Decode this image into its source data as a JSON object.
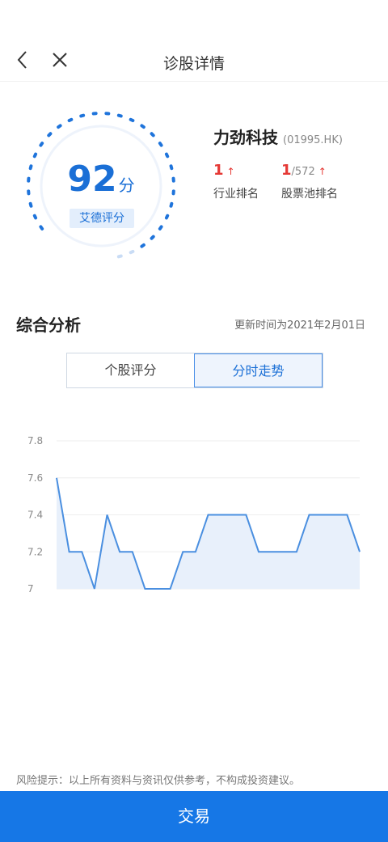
{
  "nav": {
    "title": "诊股详情",
    "back_icon": "chevron-left-icon",
    "close_icon": "close-icon"
  },
  "score": {
    "value": "92",
    "unit": "分",
    "label": "艾德评分",
    "level": 0.92
  },
  "stock": {
    "name": "力劲科技",
    "code": "(01995.HK)",
    "industry_rank": {
      "value": "1",
      "label": "行业排名"
    },
    "pool_rank": {
      "value": "1",
      "total": "/572",
      "label": "股票池排名"
    }
  },
  "analysis": {
    "title": "综合分析",
    "update_time": "更新时间为2021年2月01日"
  },
  "tabs": [
    {
      "label": "个股评分",
      "active": false
    },
    {
      "label": "分时走势",
      "active": true
    }
  ],
  "chart_data": {
    "type": "area",
    "ylim": [
      7,
      7.8
    ],
    "yticks": [
      "7.8",
      "7.6",
      "7.4",
      "7.2",
      "7"
    ],
    "values": [
      7.6,
      7.2,
      7.2,
      7.0,
      7.4,
      7.2,
      7.2,
      7.0,
      7.0,
      7.0,
      7.2,
      7.2,
      7.4,
      7.4,
      7.4,
      7.4,
      7.2,
      7.2,
      7.2,
      7.2,
      7.4,
      7.4,
      7.4,
      7.4,
      7.2
    ],
    "colors": {
      "line": "#4a8fe0",
      "fill": "#e8f0fb",
      "grid": "#eeeeee"
    }
  },
  "footer": {
    "risk_notice": "风险提示：以上所有资料与资讯仅供参考，不构成投资建议。",
    "trade_label": "交易"
  },
  "colors": {
    "accent": "#1677e6",
    "rank": "#e53935"
  }
}
